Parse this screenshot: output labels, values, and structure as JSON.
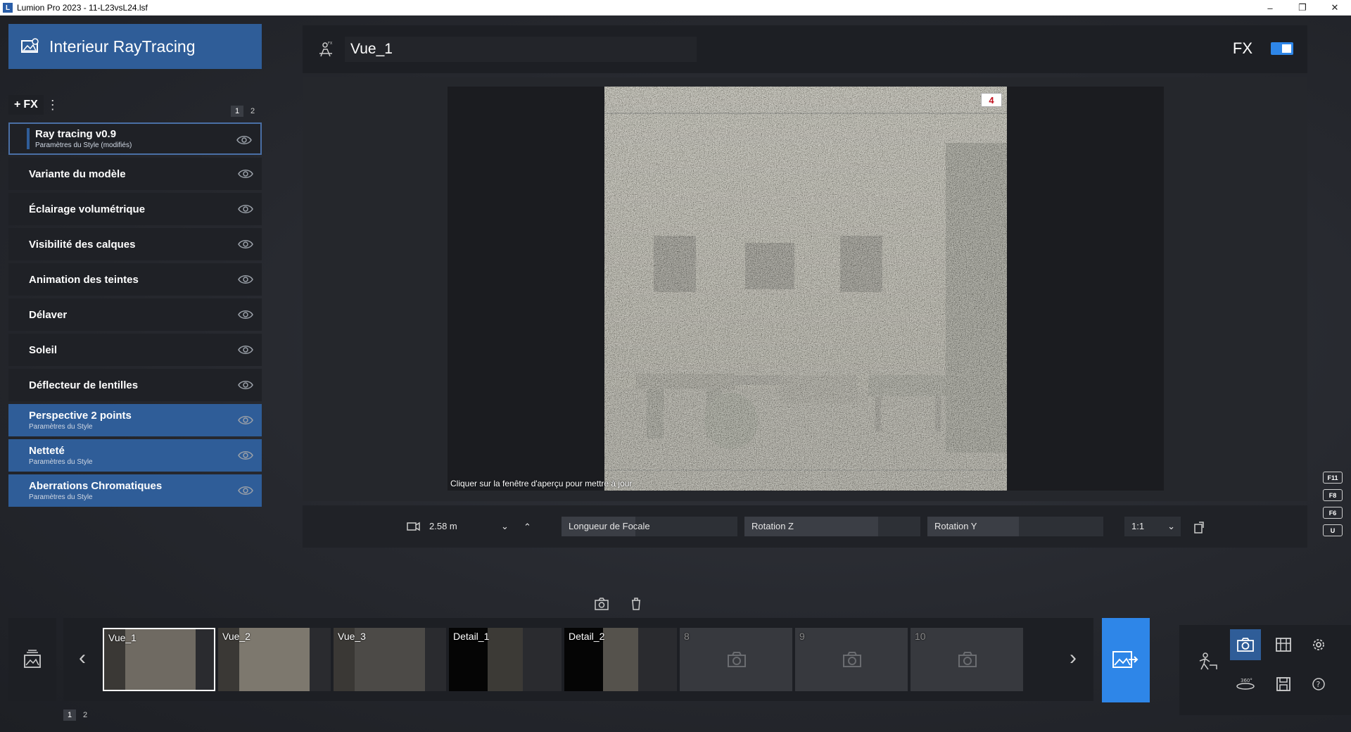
{
  "window": {
    "title": "Lumion Pro 2023 - 11-L23vsL24.lsf",
    "app_icon_letter": "L",
    "controls": [
      "–",
      "❐",
      "✕"
    ]
  },
  "scene": {
    "title": "Interieur RayTracing"
  },
  "fx_panel": {
    "add_label": "FX",
    "pages": [
      "1",
      "2"
    ],
    "effects": [
      {
        "name": "Ray tracing v0.9",
        "sub": "Paramètres du Style (modifiés)",
        "state": "selected"
      },
      {
        "name": "Variante du modèle",
        "sub": "",
        "state": "normal"
      },
      {
        "name": "Éclairage volumétrique",
        "sub": "",
        "state": "normal"
      },
      {
        "name": "Visibilité des calques",
        "sub": "",
        "state": "normal"
      },
      {
        "name": "Animation des teintes",
        "sub": "",
        "state": "normal"
      },
      {
        "name": "Délaver",
        "sub": "",
        "state": "normal"
      },
      {
        "name": "Soleil",
        "sub": "",
        "state": "normal"
      },
      {
        "name": "Déflecteur de lentilles",
        "sub": "",
        "state": "normal"
      },
      {
        "name": "Perspective 2 points",
        "sub": "Paramètres du Style",
        "state": "blue"
      },
      {
        "name": "Netteté",
        "sub": "Paramètres du Style",
        "state": "blue"
      },
      {
        "name": "Aberrations Chromatiques",
        "sub": "Paramètres du Style",
        "state": "blue"
      }
    ]
  },
  "viewport": {
    "view_name": "Vue_1",
    "fx_label": "FX",
    "fx_enabled": true,
    "badge": "4",
    "hint": "Cliquer sur la fenêtre d'aperçu pour mettre à jour"
  },
  "controls": {
    "height_value": "2.58 m",
    "focal_label": "Longueur de Focale",
    "focal_fill": 0.42,
    "rotz_label": "Rotation Z",
    "rotz_fill": 0.76,
    "roty_label": "Rotation Y",
    "roty_fill": 0.52,
    "ratio": "1:1"
  },
  "fkeys": [
    "F11",
    "F8",
    "F6",
    "U"
  ],
  "thumbnails": [
    {
      "label": "Vue_1",
      "empty": false,
      "active": true
    },
    {
      "label": "Vue_2",
      "empty": false,
      "active": false
    },
    {
      "label": "Vue_3",
      "empty": false,
      "active": false
    },
    {
      "label": "Detail_1",
      "empty": false,
      "active": false
    },
    {
      "label": "Detail_2",
      "empty": false,
      "active": false
    },
    {
      "label": "8",
      "empty": true,
      "active": false
    },
    {
      "label": "9",
      "empty": true,
      "active": false
    },
    {
      "label": "10",
      "empty": true,
      "active": false
    }
  ],
  "bottom_pages": [
    "1",
    "2"
  ],
  "colors": {
    "accent_blue": "#2f5d98",
    "render_blue": "#2e86e8"
  }
}
